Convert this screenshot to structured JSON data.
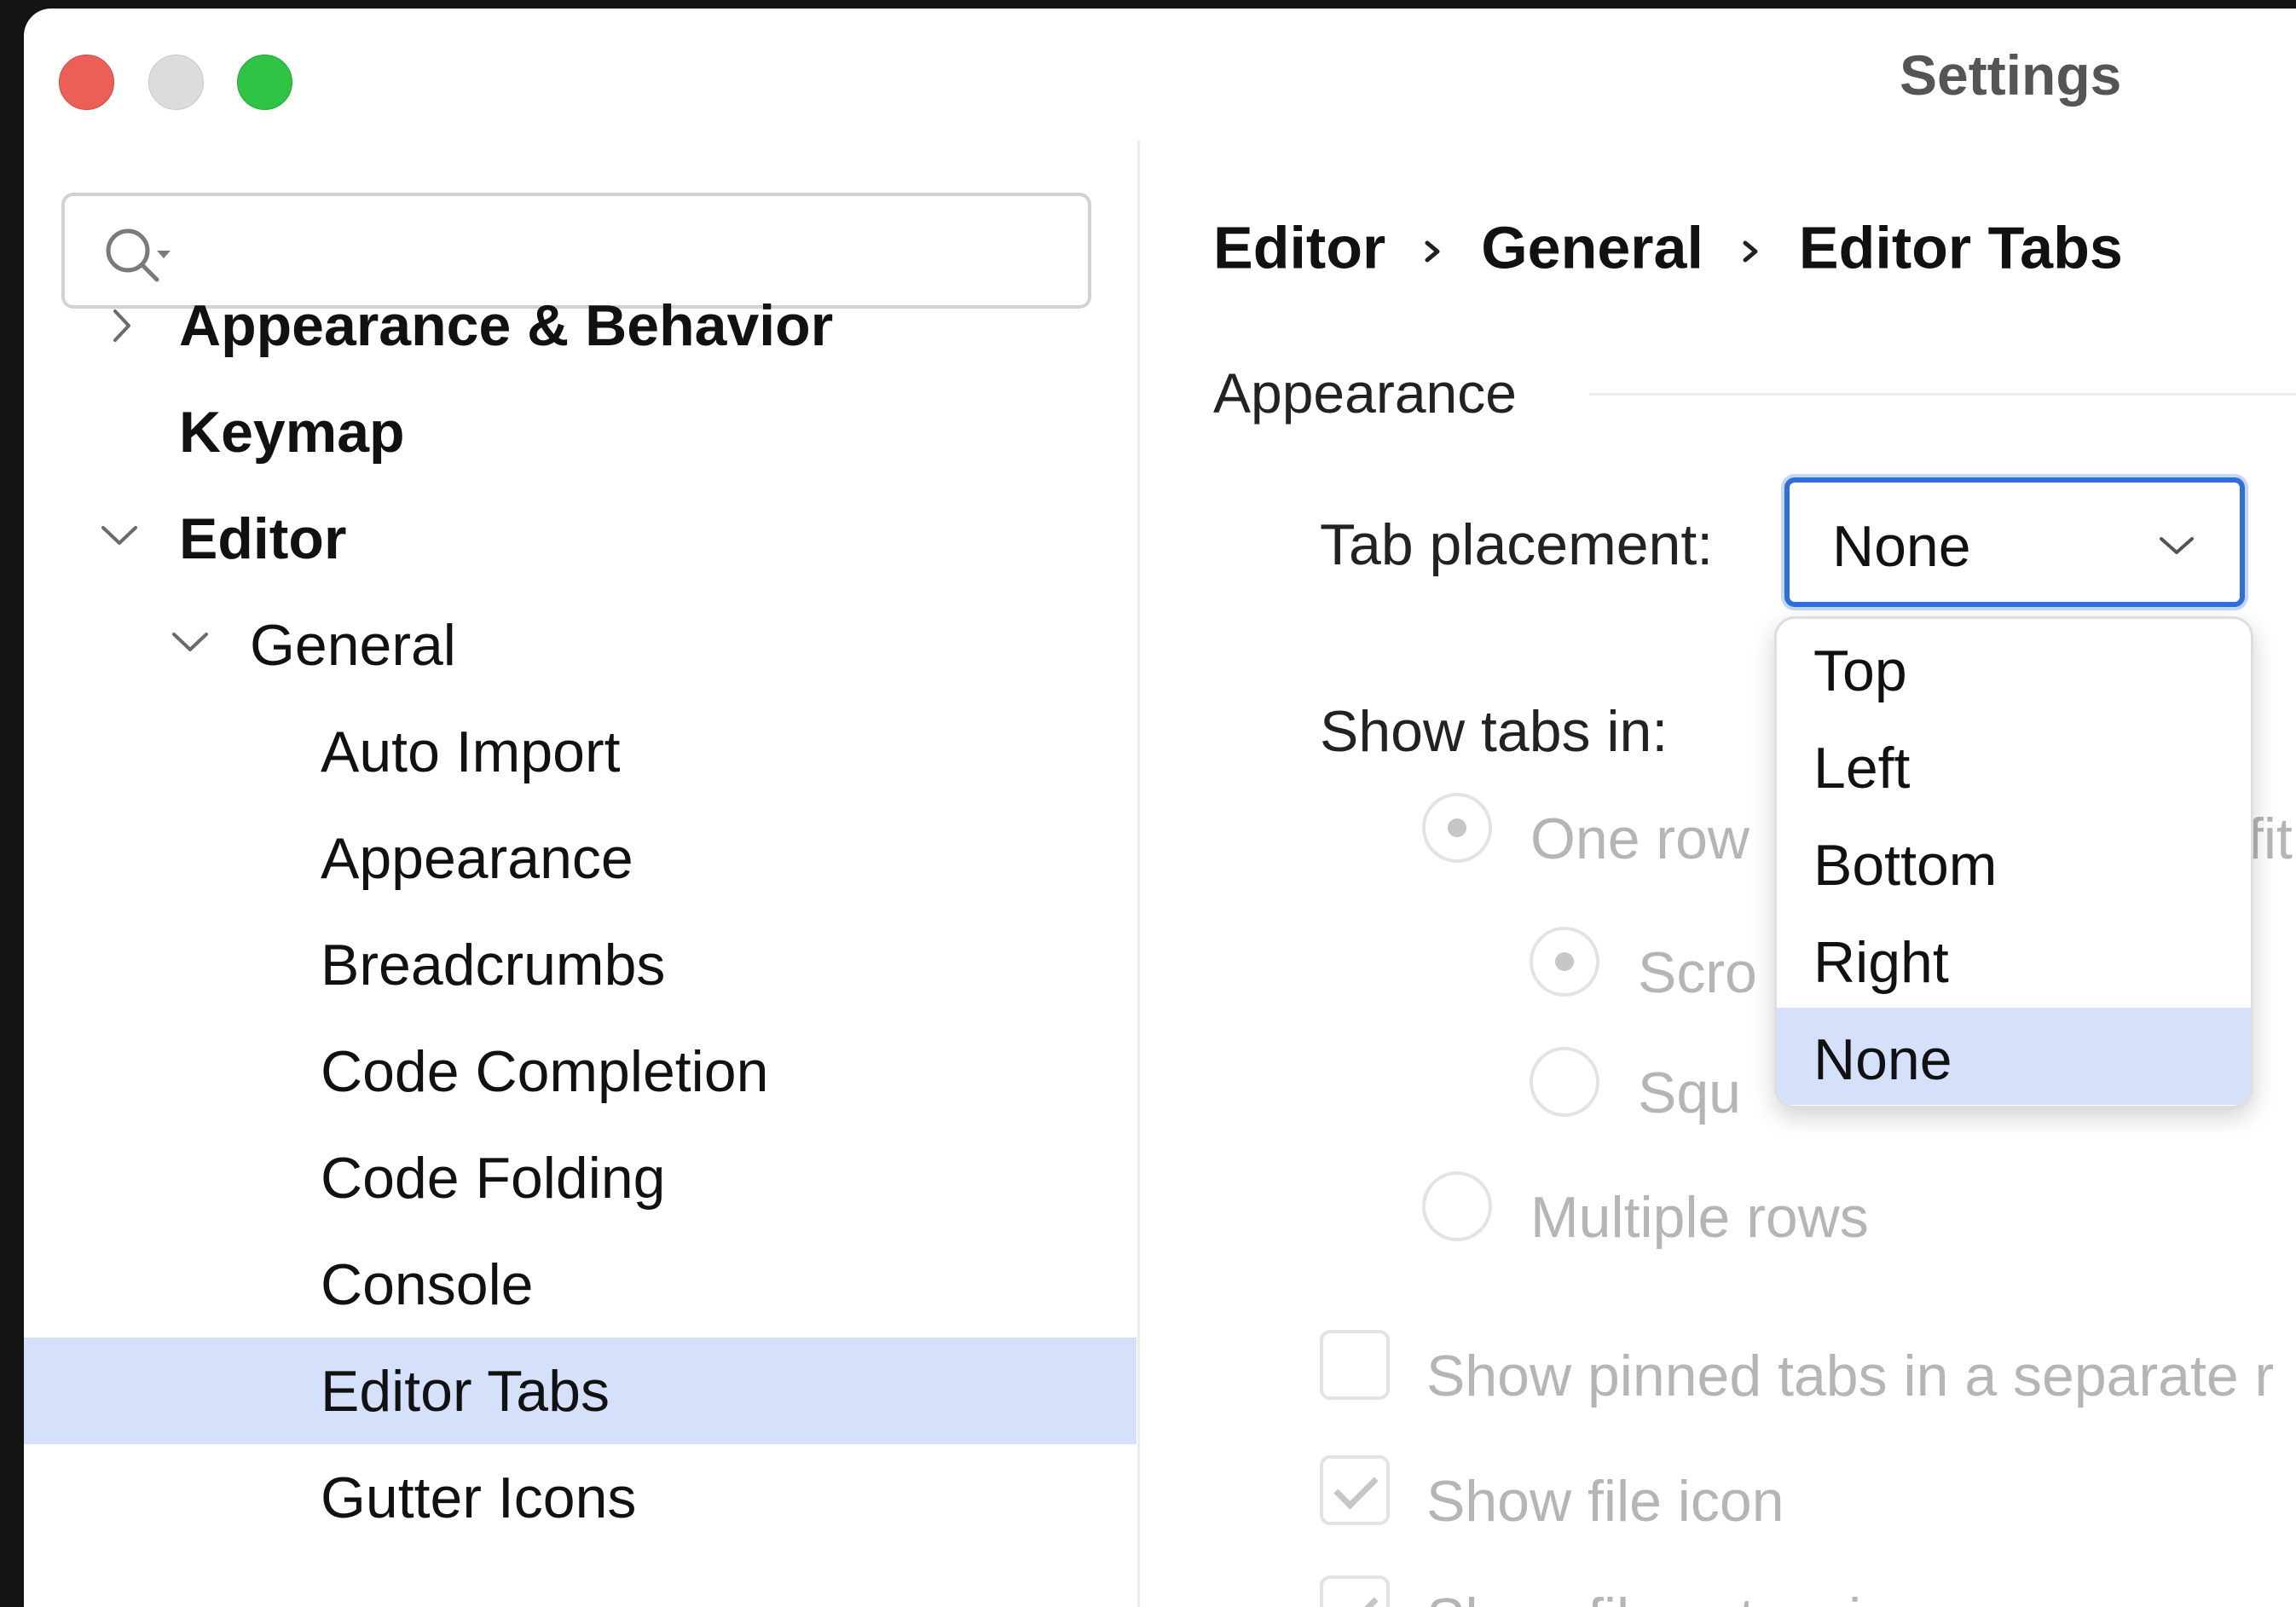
{
  "window": {
    "title": "Settings"
  },
  "search": {
    "placeholder": "",
    "value": ""
  },
  "sidebar": {
    "items": [
      {
        "label": "Appearance & Behavior"
      },
      {
        "label": "Keymap"
      },
      {
        "label": "Editor"
      },
      {
        "label": "General"
      },
      {
        "label": "Auto Import"
      },
      {
        "label": "Appearance"
      },
      {
        "label": "Breadcrumbs"
      },
      {
        "label": "Code Completion"
      },
      {
        "label": "Code Folding"
      },
      {
        "label": "Console"
      },
      {
        "label": "Editor Tabs"
      },
      {
        "label": "Gutter Icons"
      }
    ],
    "selected": "Editor Tabs"
  },
  "breadcrumb": [
    "Editor",
    "General",
    "Editor Tabs"
  ],
  "section": {
    "title": "Appearance"
  },
  "tab_placement": {
    "label": "Tab placement:",
    "value": "None",
    "options": [
      "Top",
      "Left",
      "Bottom",
      "Right",
      "None"
    ],
    "highlighted": "None"
  },
  "show_tabs_in": {
    "label": "Show tabs in:",
    "one_row_text": "One row",
    "one_row_tail": "fit",
    "scroll_text": "Scro",
    "square_text": "Squ",
    "multiple_rows_text": "Multiple rows"
  },
  "checkboxes": [
    {
      "label": "Show pinned tabs in a separate r",
      "checked": false
    },
    {
      "label": "Show file icon",
      "checked": true
    },
    {
      "label": "Show file extension",
      "checked": true
    }
  ],
  "colors": {
    "accent": "#2f6fdb",
    "selection": "#d5e0fb",
    "disabled_text": "#b5b5b5"
  }
}
